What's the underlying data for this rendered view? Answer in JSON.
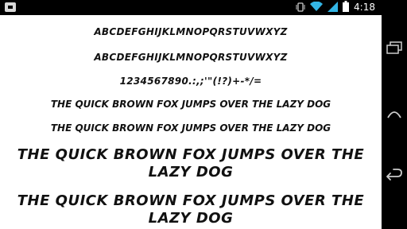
{
  "status_bar": {
    "time": "4:18",
    "icons": [
      "notification-icon",
      "vibrate-icon",
      "wifi-icon",
      "cell-signal-icon",
      "battery-icon"
    ]
  },
  "nav_bar": {
    "buttons": [
      "recent-apps",
      "back",
      "home"
    ]
  },
  "preview": {
    "lines": [
      "ABCDEFGHIJKLMNOPQRSTUVWXYZ",
      "ABCDEFGHIJKLMNOPQRSTUVWXYZ",
      "1234567890.:,;'\"(!?)+-*/=",
      "THE QUICK BROWN FOX JUMPS OVER THE LAZY DOG",
      "THE QUICK BROWN FOX JUMPS OVER THE LAZY DOG",
      "THE QUICK BROWN FOX JUMPS OVER THE LAZY DOG",
      "THE QUICK BROWN FOX JUMPS OVER THE LAZY DOG"
    ]
  },
  "colors": {
    "bar_background": "#000000",
    "page_background": "#ffffff",
    "text": "#111111",
    "wifi_accent": "#33b5e5"
  }
}
